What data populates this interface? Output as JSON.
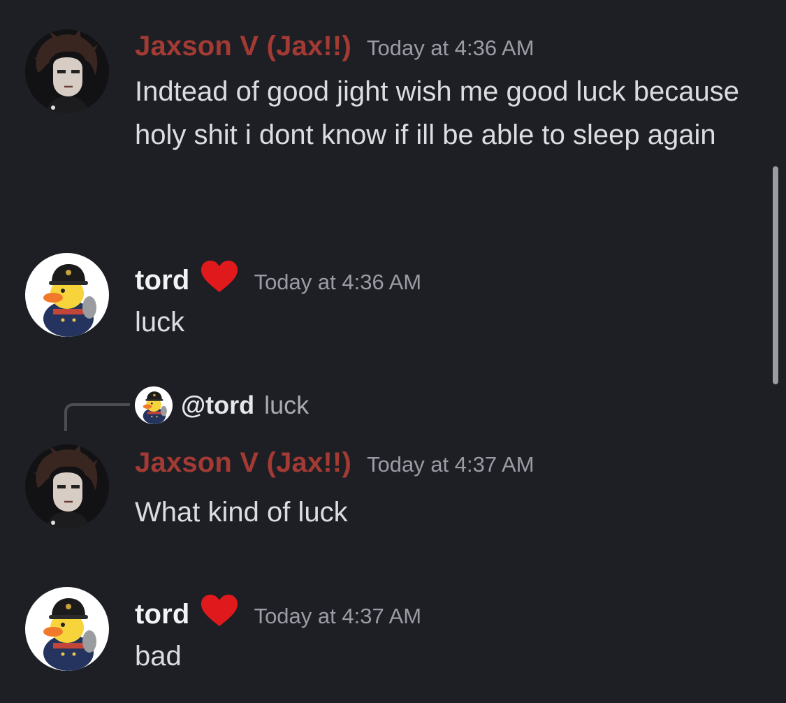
{
  "messages": [
    {
      "author": "Jaxson V (Jax!!)",
      "timestamp": "Today at 4:36 AM",
      "content": "Indtead of good jight wish me good luck because holy shit i dont know if ill be able to sleep again",
      "avatar": "jax-avatar"
    },
    {
      "author": "tord",
      "badge": "heart-icon",
      "timestamp": "Today at 4:36 AM",
      "content": "luck",
      "avatar": "duck-avatar"
    },
    {
      "reply": {
        "mention": "@tord",
        "text": "luck"
      },
      "author": "Jaxson V (Jax!!)",
      "timestamp": "Today at 4:37 AM",
      "content": "What kind of luck",
      "avatar": "jax-avatar"
    },
    {
      "author": "tord",
      "badge": "heart-icon",
      "timestamp": "Today at 4:37 AM",
      "content": "bad",
      "avatar": "duck-avatar"
    }
  ],
  "colors": {
    "background": "#1e1f24",
    "jax_name": "#a33a34",
    "tord_name": "#f2f3f5",
    "heart": "#e0191c",
    "timestamp": "#9a9ca6",
    "message_text": "#dcdde1"
  }
}
